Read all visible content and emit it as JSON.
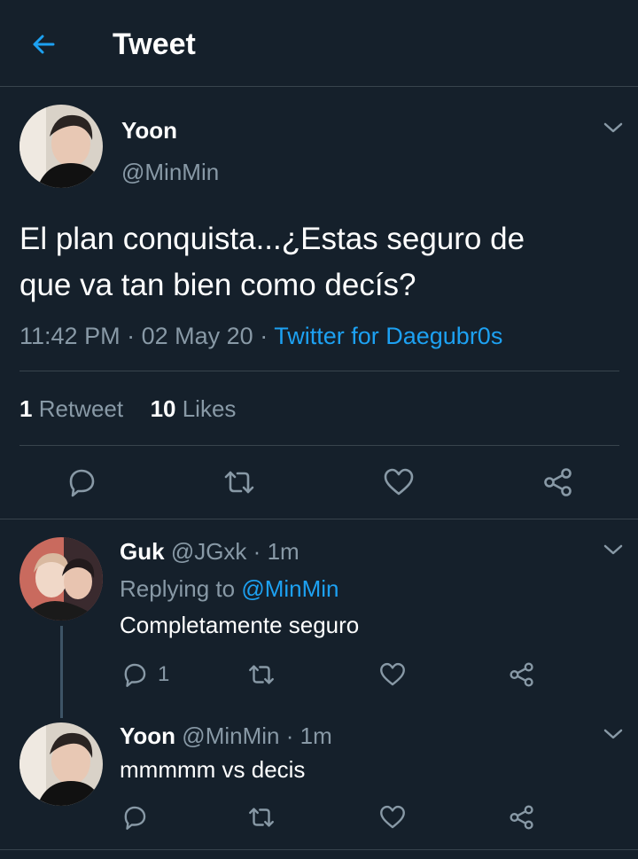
{
  "header": {
    "title": "Tweet",
    "back_icon": "arrow-left-icon"
  },
  "main_tweet": {
    "name": "Yoon",
    "handle": "@MinMin",
    "text_line1": "El plan conquista...¿Estas seguro de",
    "text_line2": "que va tan bien como decís?",
    "time": "11:42 PM",
    "sep1": "·",
    "date": "02 May 20",
    "sep2": "·",
    "source": "Twitter for Daegubr0s",
    "retweets_count": "1",
    "retweets_label": "Retweet",
    "likes_count": "10",
    "likes_label": "Likes"
  },
  "replies": [
    {
      "name": "Guk",
      "handle": "@JGxk",
      "dot": "·",
      "time": "1m",
      "replying_prefix": "Replying to",
      "replying_to": "@MinMin",
      "text": "Completamente seguro",
      "reply_count": "1"
    },
    {
      "name": "Yoon",
      "handle": "@MinMin",
      "dot": "·",
      "time": "1m",
      "text": "mmmmm vs decis"
    }
  ],
  "colors": {
    "background": "#15202b",
    "accent": "#1da1f2",
    "muted": "#8899a6",
    "divider": "#38444d"
  }
}
